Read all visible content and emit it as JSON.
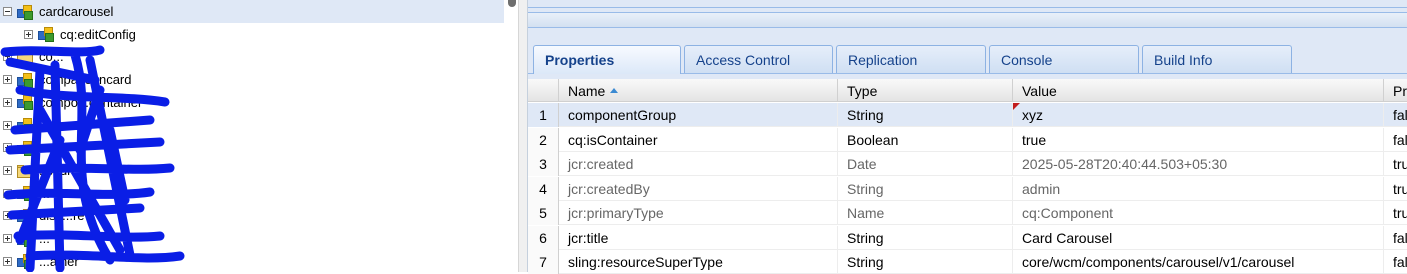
{
  "tree": {
    "items": [
      {
        "label": "cardcarousel",
        "type": "component",
        "expanded": true,
        "indent": 0,
        "selected": true
      },
      {
        "label": "cq:editConfig",
        "type": "component",
        "expanded": false,
        "indent": 1,
        "selected": false
      },
      {
        "label": "co...",
        "type": "folder",
        "expanded": false,
        "indent": 0,
        "selected": false
      },
      {
        "label": "comparisoncard",
        "type": "component",
        "expanded": false,
        "indent": 0,
        "selected": false
      },
      {
        "label": "compo...container",
        "type": "component",
        "expanded": false,
        "indent": 0,
        "selected": false
      },
      {
        "label": "...a",
        "type": "component",
        "expanded": false,
        "indent": 0,
        "selected": false
      },
      {
        "label": "...",
        "type": "component",
        "expanded": false,
        "indent": 0,
        "selected": false
      },
      {
        "label": "...xtures",
        "type": "folder",
        "expanded": false,
        "indent": 0,
        "selected": false
      },
      {
        "label": "...",
        "type": "component",
        "expanded": false,
        "indent": 0,
        "selected": false
      },
      {
        "label": "disc...re",
        "type": "component",
        "expanded": false,
        "indent": 0,
        "selected": false
      },
      {
        "label": "...",
        "type": "component",
        "expanded": false,
        "indent": 0,
        "selected": false
      },
      {
        "label": "...ainer",
        "type": "component",
        "expanded": false,
        "indent": 0,
        "selected": false
      }
    ]
  },
  "tabs": [
    {
      "label": "Properties",
      "active": true
    },
    {
      "label": "Access Control",
      "active": false
    },
    {
      "label": "Replication",
      "active": false
    },
    {
      "label": "Console",
      "active": false
    },
    {
      "label": "Build Info",
      "active": false
    }
  ],
  "grid": {
    "columns": {
      "name": "Name",
      "type": "Type",
      "value": "Value",
      "protected": "Pro"
    },
    "sort": {
      "column": "name",
      "direction": "asc"
    },
    "rows": [
      {
        "num": "1",
        "name": "componentGroup",
        "type": "String",
        "value": "xyz",
        "protected": "false",
        "muted": false,
        "selected": true,
        "dirty": true
      },
      {
        "num": "2",
        "name": "cq:isContainer",
        "type": "Boolean",
        "value": "true",
        "protected": "false",
        "muted": false,
        "selected": false,
        "dirty": false
      },
      {
        "num": "3",
        "name": "jcr:created",
        "type": "Date",
        "value": "2025-05-28T20:40:44.503+05:30",
        "protected": "true",
        "muted": true,
        "selected": false,
        "dirty": false
      },
      {
        "num": "4",
        "name": "jcr:createdBy",
        "type": "String",
        "value": "admin",
        "protected": "true",
        "muted": true,
        "selected": false,
        "dirty": false
      },
      {
        "num": "5",
        "name": "jcr:primaryType",
        "type": "Name",
        "value": "cq:Component",
        "protected": "true",
        "muted": true,
        "selected": false,
        "dirty": false
      },
      {
        "num": "6",
        "name": "jcr:title",
        "type": "String",
        "value": "Card Carousel",
        "protected": "false",
        "muted": false,
        "selected": false,
        "dirty": false
      },
      {
        "num": "7",
        "name": "sling:resourceSuperType",
        "type": "String",
        "value": "core/wcm/components/carousel/v1/carousel",
        "protected": "false",
        "muted": false,
        "selected": false,
        "dirty": false
      }
    ]
  },
  "colors": {
    "accent": "#15428b",
    "selection": "#dfe8f6",
    "scribble": "#0a1ee6"
  }
}
